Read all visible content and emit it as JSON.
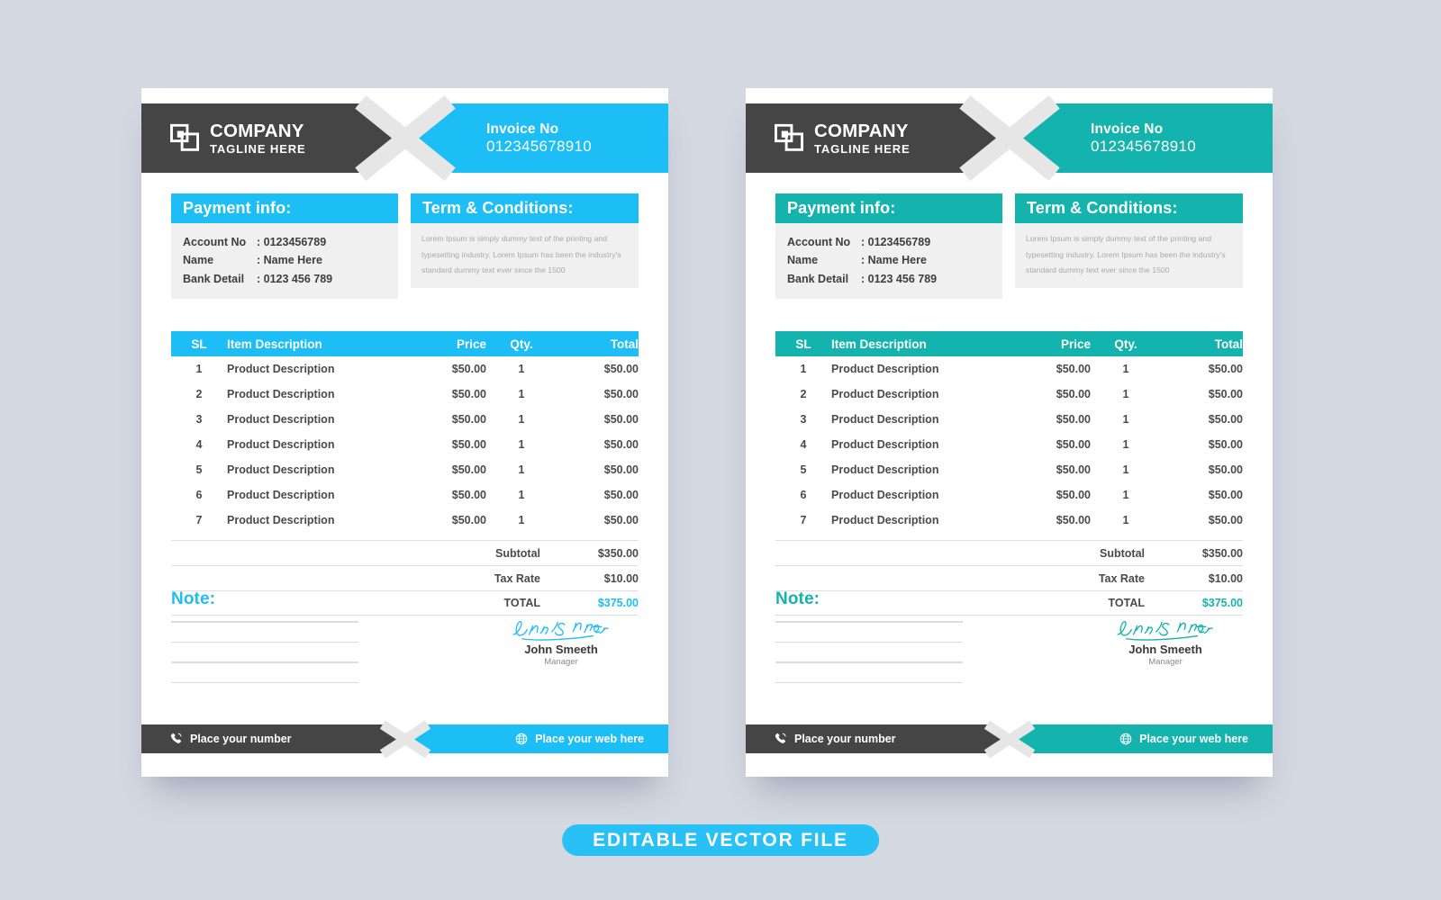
{
  "background_color": "#d4d8e1",
  "badge": {
    "label": "EDITABLE VECTOR  FILE",
    "color": "#29c0f5"
  },
  "variants": [
    {
      "id": "blue",
      "accent": "#1CBEF5",
      "dark": "#454545"
    },
    {
      "id": "teal",
      "accent": "#15B3AD",
      "dark": "#454545"
    }
  ],
  "invoice": {
    "header": {
      "brand_name": "COMPANY",
      "brand_tagline": "TAGLINE HERE",
      "logo_icon": "overlapping-squares-icon",
      "invoice_label": "Invoice No",
      "invoice_number": "012345678910"
    },
    "payment_info": {
      "title": "Payment info:",
      "rows": [
        {
          "key": "Account No",
          "value": ": 0123456789"
        },
        {
          "key": "Name",
          "value": ": Name Here"
        },
        {
          "key": "Bank Detail",
          "value": ": 0123 456 789"
        }
      ]
    },
    "terms": {
      "title": "Term & Conditions:",
      "body": "Lorem Ipsum is simply dummy text of the printing and typesetting industry. Lorem Ipsum has been the industry's standard dummy text ever since the 1500"
    },
    "table": {
      "columns": [
        "SL",
        "Item Description",
        "Price",
        "Qty.",
        "Total"
      ],
      "rows": [
        {
          "sl": "1",
          "desc": "Product Description",
          "price": "$50.00",
          "qty": "1",
          "total": "$50.00"
        },
        {
          "sl": "2",
          "desc": "Product Description",
          "price": "$50.00",
          "qty": "1",
          "total": "$50.00"
        },
        {
          "sl": "3",
          "desc": "Product Description",
          "price": "$50.00",
          "qty": "1",
          "total": "$50.00"
        },
        {
          "sl": "4",
          "desc": "Product Description",
          "price": "$50.00",
          "qty": "1",
          "total": "$50.00"
        },
        {
          "sl": "5",
          "desc": "Product Description",
          "price": "$50.00",
          "qty": "1",
          "total": "$50.00"
        },
        {
          "sl": "6",
          "desc": "Product Description",
          "price": "$50.00",
          "qty": "1",
          "total": "$50.00"
        },
        {
          "sl": "7",
          "desc": "Product Description",
          "price": "$50.00",
          "qty": "1",
          "total": "$50.00"
        }
      ]
    },
    "summary": [
      {
        "label": "Subtotal",
        "value": "$350.00"
      },
      {
        "label": "Tax Rate",
        "value": "$10.00"
      },
      {
        "label": "TOTAL",
        "value": "$375.00"
      }
    ],
    "note": {
      "title": "Note:",
      "line_count": 4
    },
    "signature": {
      "script_name": "John Smeeth",
      "name": "John Smeeth",
      "role": "Manager"
    },
    "footer": {
      "phone_icon": "phone-icon",
      "phone_label": "Place your number",
      "web_icon": "globe-icon",
      "web_label": "Place your web here"
    }
  }
}
